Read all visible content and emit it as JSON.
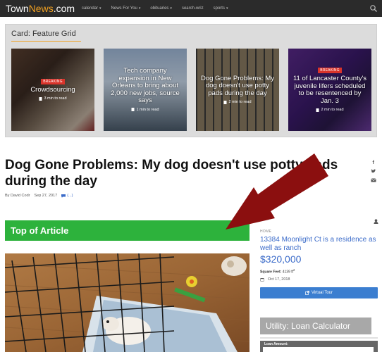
{
  "nav": {
    "logo_main": "Town",
    "logo_accent": "News",
    "logo_suffix": ".com",
    "items": [
      {
        "label": "calendar"
      },
      {
        "label": "News For You"
      },
      {
        "label": "obituaries"
      },
      {
        "label": "search-wriz"
      },
      {
        "label": "sports"
      }
    ]
  },
  "card_grid": {
    "title": "Card: Feature Grid",
    "tiles": [
      {
        "badge": "Breaking",
        "title": "Crowdsourcing",
        "read_time": "3 min to read"
      },
      {
        "badge": "",
        "title": "Tech company expansion in New Orleans to bring about 2,000 new jobs, source says",
        "read_time": "1 min to read"
      },
      {
        "badge": "",
        "title": "Dog Gone Problems: My dog doesn't use potty pads during the day",
        "read_time": "2 min to read"
      },
      {
        "badge": "Breaking",
        "title": "11 of Lancaster County's juvenile lifers scheduled to be resentenced by Jan. 3",
        "read_time": "2 min to read"
      }
    ]
  },
  "article": {
    "headline": "Dog Gone Problems: My dog doesn't use potty pads during the day",
    "author": "By David Codr",
    "date": "Sep 27, 2017",
    "comments": "(...)",
    "ad_label": "Top of Article"
  },
  "sidebar": {
    "kicker": "HOME",
    "listing_title": "13384 Moonlight Ct is a residence as well as ranch",
    "price": "$320,000",
    "sqft_label": "Square Feet:",
    "sqft_value": "4139 ft",
    "sqft_sup": "2",
    "date": "Oct 17, 2018",
    "tour_button": "Virtual Tour",
    "utility_title": "Utility: Loan Calculator",
    "loan_label": "Loan Amount:"
  },
  "colors": {
    "accent_orange": "#f0a020",
    "breaking_red": "#d9342b",
    "link_blue": "#3b6bc9",
    "ad_green": "#2db23c",
    "arrow_red": "#8b0f0f"
  }
}
